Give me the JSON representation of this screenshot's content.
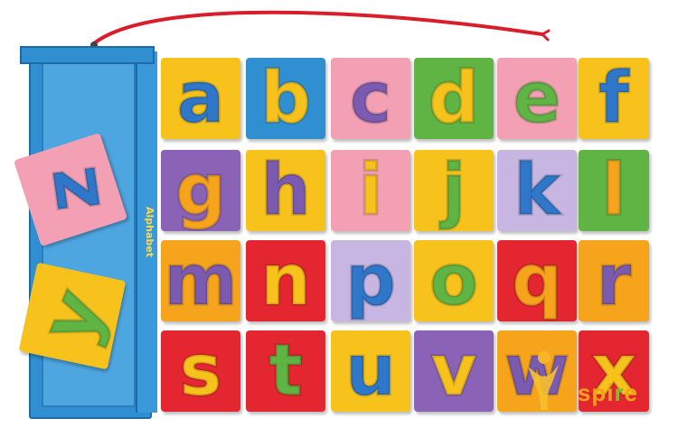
{
  "scene": {
    "description_colors": {
      "box": "#2f8fd0",
      "cord": "#d81e2a"
    },
    "tiles": [
      {
        "letter": "a",
        "bg": "#f6c21b",
        "fg": "#2f77c9"
      },
      {
        "letter": "b",
        "bg": "#2f8fd0",
        "fg": "#f6c21b"
      },
      {
        "letter": "c",
        "bg": "#f4a0b4",
        "fg": "#7b5bb0"
      },
      {
        "letter": "d",
        "bg": "#5fb443",
        "fg": "#f6c21b"
      },
      {
        "letter": "e",
        "bg": "#f4a0b4",
        "fg": "#5fb443"
      },
      {
        "letter": "f",
        "bg": "#f6c21b",
        "fg": "#2f77c9"
      },
      {
        "letter": "g",
        "bg": "#8a62b6",
        "fg": "#f6a41b"
      },
      {
        "letter": "h",
        "bg": "#f6c21b",
        "fg": "#7b5bb0"
      },
      {
        "letter": "i",
        "bg": "#f4a0b4",
        "fg": "#f6c21b"
      },
      {
        "letter": "j",
        "bg": "#f6c21b",
        "fg": "#5fb443"
      },
      {
        "letter": "k",
        "bg": "#c8b6e2",
        "fg": "#2f77c9"
      },
      {
        "letter": "l",
        "bg": "#5fb443",
        "fg": "#f6a41b"
      },
      {
        "letter": "m",
        "bg": "#f6a41b",
        "fg": "#7b5bb0"
      },
      {
        "letter": "n",
        "bg": "#e3262f",
        "fg": "#f6c21b"
      },
      {
        "letter": "p",
        "bg": "#c8b6e2",
        "fg": "#2f77c9"
      },
      {
        "letter": "o",
        "bg": "#f6c21b",
        "fg": "#5fb443"
      },
      {
        "letter": "q",
        "bg": "#e3262f",
        "fg": "#f6a41b"
      },
      {
        "letter": "r",
        "bg": "#f6a41b",
        "fg": "#7b5bb0"
      },
      {
        "letter": "s",
        "bg": "#e3262f",
        "fg": "#f6c21b"
      },
      {
        "letter": "t",
        "bg": "#e3262f",
        "fg": "#5fb443"
      },
      {
        "letter": "u",
        "bg": "#f6c21b",
        "fg": "#2f77c9"
      },
      {
        "letter": "v",
        "bg": "#8a62b6",
        "fg": "#f6c21b"
      },
      {
        "letter": "w",
        "bg": "#f6a41b",
        "fg": "#7b5bb0"
      },
      {
        "letter": "x",
        "bg": "#e3262f",
        "fg": "#f6c21b"
      }
    ],
    "box_tiles": [
      {
        "letter": "z",
        "bg": "#f4a0b4",
        "fg": "#2f77c9"
      },
      {
        "letter": "y",
        "bg": "#f6c21b",
        "fg": "#5fb443"
      }
    ],
    "box_side_label": "Alphabet",
    "logo": {
      "prefix": "nspi",
      "r": "r",
      "suffix": "e"
    }
  }
}
